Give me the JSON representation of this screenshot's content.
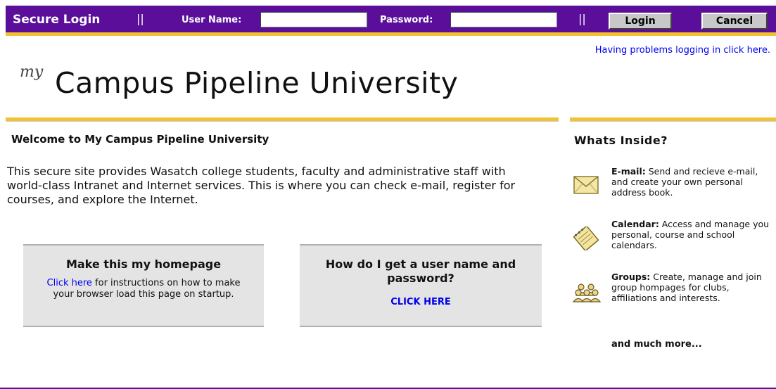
{
  "topbar": {
    "title": "Secure Login",
    "separator": "||",
    "username_label": "User Name:",
    "username_value": "",
    "password_label": "Password:",
    "password_value": "",
    "login_label": "Login",
    "cancel_label": "Cancel"
  },
  "help_link": "Having problems logging in click here.",
  "logo": {
    "prefix": "my",
    "name": "Campus Pipeline University"
  },
  "welcome": {
    "title": "Welcome to My Campus Pipeline University",
    "body": "This secure site provides Wasatch college students,  faculty and administrative staff with world-class Intranet and Internet services. This is where you can check e-mail, register for courses, and explore the Internet."
  },
  "homepage_box": {
    "title": "Make this my homepage",
    "link": "Click here",
    "text": " for instructions on how to make your browser load this page on startup."
  },
  "username_box": {
    "title": "How do I get a user name and password?",
    "link": "CLICK HERE"
  },
  "sidebar": {
    "title": "Whats Inside?",
    "items": [
      {
        "icon": "envelope-icon",
        "name": "E-mail:",
        "text": " Send and recieve e-mail, and create your own personal address book."
      },
      {
        "icon": "notepad-icon",
        "name": "Calendar:",
        "text": " Access and manage you personal, course and school calendars."
      },
      {
        "icon": "people-group-icon",
        "name": "Groups:",
        "text": " Create, manage and join group hompages for clubs, affiliations and interests."
      }
    ],
    "more": "and much more..."
  },
  "colors": {
    "purple": "#5a0e9a",
    "gold": "#f2c230",
    "link": "#0000ee",
    "box_bg": "#e4e4e4"
  }
}
